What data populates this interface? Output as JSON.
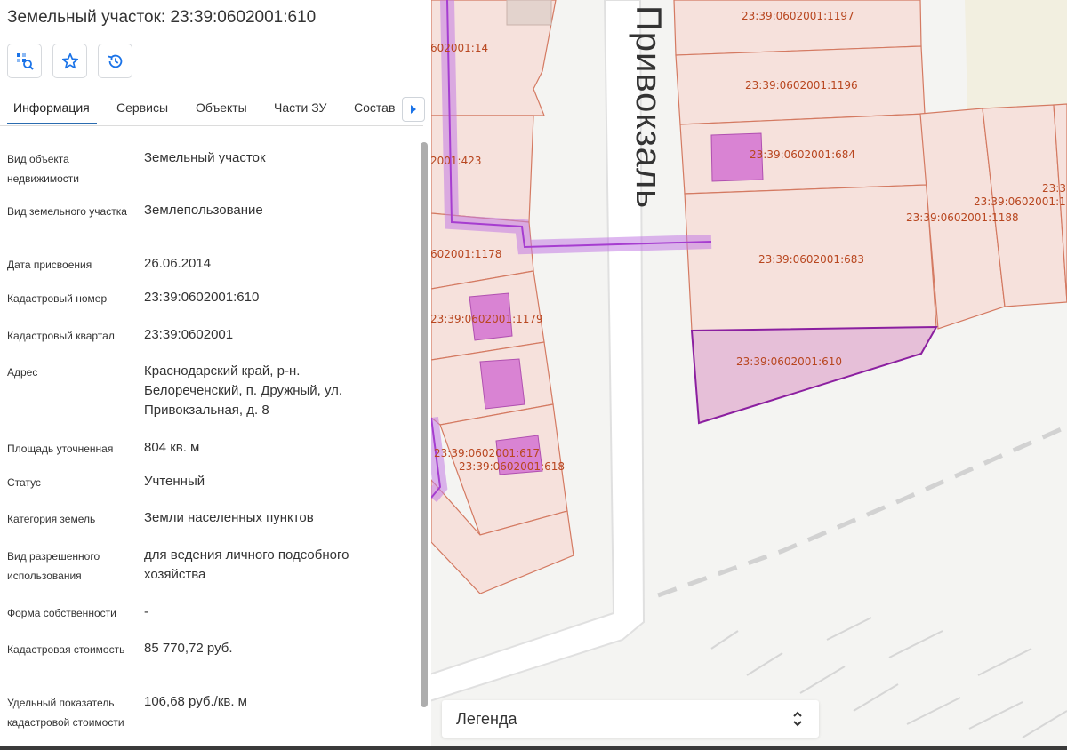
{
  "panel": {
    "title": "Земельный участок: 23:39:0602001:610",
    "tools": [
      {
        "icon": "zoom-to-object-icon"
      },
      {
        "icon": "star-icon"
      },
      {
        "icon": "history-icon"
      }
    ],
    "tabs": [
      "Информация",
      "Сервисы",
      "Объекты",
      "Части ЗУ",
      "Состав"
    ],
    "active_tab": "Информация",
    "rows": [
      {
        "label": "Вид объекта недвижимости",
        "value": "Земельный участок"
      },
      {
        "label": "Вид земельного участка",
        "value": "Землепользование"
      },
      {
        "label": "Дата присвоения",
        "value": "26.06.2014"
      },
      {
        "label": "Кадастровый номер",
        "value": "23:39:0602001:610"
      },
      {
        "label": "Кадастровый квартал",
        "value": "23:39:0602001"
      },
      {
        "label": "Адрес",
        "value": "Краснодарский край, р-н. Белореченский, п. Дружный, ул. Привокзальная, д. 8"
      },
      {
        "label": "Площадь уточненная",
        "value": "804 кв. м"
      },
      {
        "label": "Статус",
        "value": "Учтенный"
      },
      {
        "label": "Категория земель",
        "value": "Земли населенных пунктов"
      },
      {
        "label": "Вид разрешенного использования",
        "value": "для ведения личного подсобного хозяйства"
      },
      {
        "label": "Форма собственности",
        "value": "-"
      },
      {
        "label": "Кадастровая стоимость",
        "value": "85 770,72 руб."
      },
      {
        "label": "Удельный показатель кадастровой стоимости",
        "value": "106,68 руб./кв. м"
      }
    ]
  },
  "map": {
    "street_label": "Привокзаль",
    "parcel_labels": {
      "p1197": "23:39:0602001:1197",
      "p1196": "23:39:0602001:1196",
      "p684": "23:39:0602001:684",
      "p683": "23:39:0602001:683",
      "p610": "23:39:0602001:610",
      "p1188": "23:39:0602001:1188",
      "p_right_1": "23:39:0602001:1",
      "p_right_2": "23:3",
      "p14": "602001:14",
      "p423": "2001:423",
      "p1178": "602001:1178",
      "p1179": "23:39:0602001:1179",
      "p617": "23:39:0602001:617",
      "p618": "23:39:0602001:618"
    },
    "colors": {
      "parcel_fill": "#f6e1dc",
      "parcel_stroke": "#d47a62",
      "building_fill": "#d983d3",
      "selected_fill": "#e6bfd8",
      "selected_stroke": "#8b1fa0",
      "boundary": "#a63dd0",
      "label": "#b8461f"
    }
  },
  "legend": {
    "label": "Легенда"
  }
}
